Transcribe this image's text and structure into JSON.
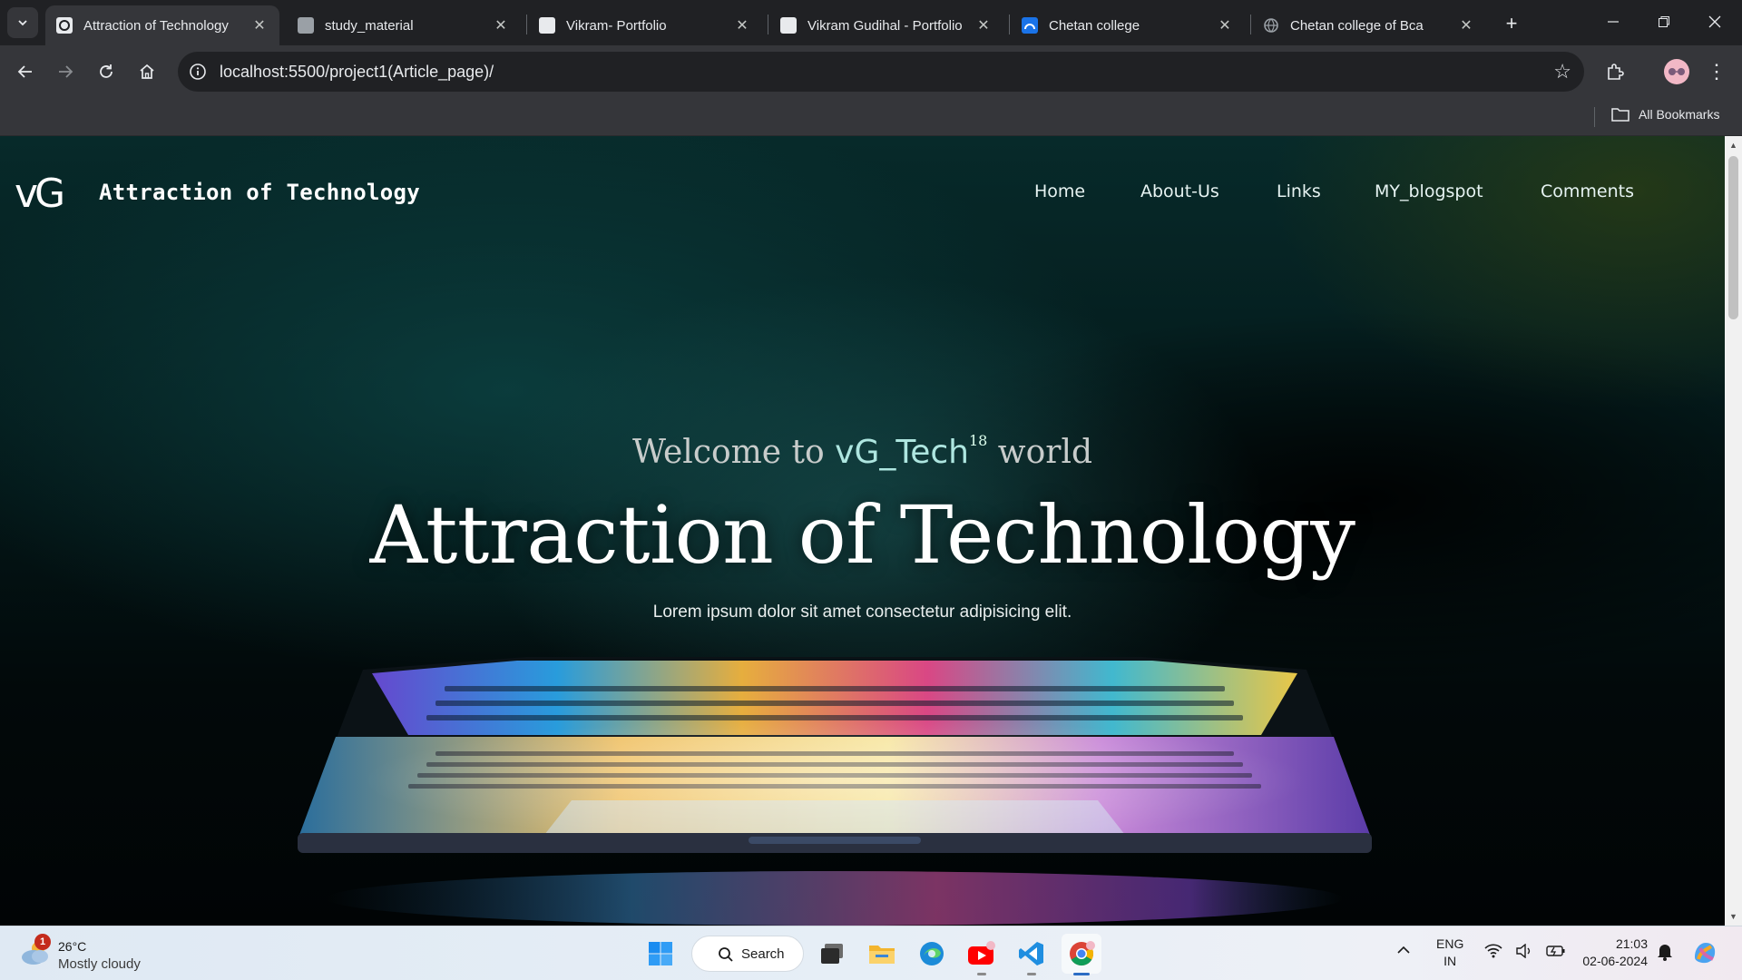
{
  "browser": {
    "tabs": [
      {
        "title": "Attraction of Technology",
        "active": true,
        "favicon": "vg-logo-icon"
      },
      {
        "title": "study_material",
        "active": false,
        "favicon": "document-icon"
      },
      {
        "title": "Vikram- Portfolio",
        "active": false,
        "favicon": "page-icon"
      },
      {
        "title": "Vikram Gudihal - Portfolio",
        "active": false,
        "favicon": "page-icon"
      },
      {
        "title": "Chetan college",
        "active": false,
        "favicon": "college-logo-icon"
      },
      {
        "title": "Chetan college of Bca",
        "active": false,
        "favicon": "globe-icon"
      }
    ],
    "url": "localhost:5500/project1(Article_page)/",
    "bookmarks_label": "All Bookmarks",
    "accent": "#35363a"
  },
  "site": {
    "logo_text": "vG",
    "title": "Attraction of Technology",
    "nav": [
      "Home",
      "About-Us",
      "Links",
      "MY_blogspot",
      "Comments"
    ],
    "hero": {
      "welcome_prefix": "Welcome to",
      "brand": "vG_Tech",
      "brand_sup": "18",
      "welcome_suffix": "world",
      "title": "Attraction of Technology",
      "subtitle": "Lorem ipsum dolor sit amet consectetur adipisicing elit."
    }
  },
  "taskbar": {
    "weather": {
      "badge": "1",
      "temp": "26°C",
      "condition": "Mostly cloudy"
    },
    "search_label": "Search",
    "apps": [
      "windows-start-icon",
      "task-view-icon",
      "file-explorer-icon",
      "edge-icon",
      "youtube-icon",
      "vscode-icon",
      "chrome-icon"
    ],
    "language": {
      "line1": "ENG",
      "line2": "IN"
    },
    "time": "21:03",
    "date": "02-06-2024"
  }
}
